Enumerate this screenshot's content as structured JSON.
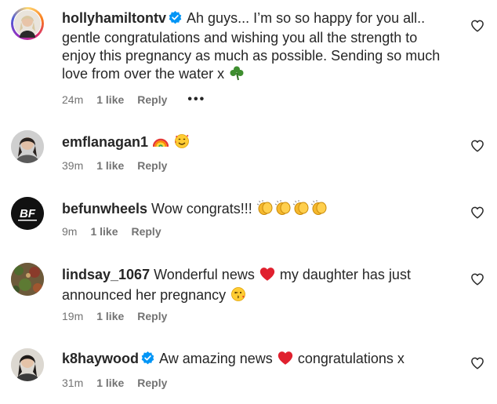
{
  "comments": [
    {
      "username": "hollyhamiltontv",
      "verified": true,
      "text_parts": [
        "Ah guys... I’m so so happy for you all.. gentle congratulations and wishing you all the strength to enjoy this pregnancy as much as possible. Sending so much love from over the water x "
      ],
      "emojis": [
        "shamrock"
      ],
      "time": "24m",
      "likes": "1 like",
      "reply": "Reply",
      "more": "•••"
    },
    {
      "username": "emflanagan1",
      "verified": false,
      "emojis": [
        "rainbow",
        "smiling-face-with-hearts"
      ],
      "time": "39m",
      "likes": "1 like",
      "reply": "Reply"
    },
    {
      "username": "befunwheels",
      "verified": false,
      "text": "Wow congrats!!!",
      "emojis": [
        "clapping-hands",
        "clapping-hands",
        "clapping-hands",
        "clapping-hands"
      ],
      "avatar_text": "BF",
      "time": "9m",
      "likes": "1 like",
      "reply": "Reply"
    },
    {
      "username": "lindsay_1067",
      "verified": false,
      "text_a": "Wonderful news",
      "text_b": "my daughter has just announced her pregnancy",
      "emojis": [
        "red-heart",
        "face-blowing-kiss"
      ],
      "time": "19m",
      "likes": "1 like",
      "reply": "Reply"
    },
    {
      "username": "k8haywood",
      "verified": true,
      "text_a": "Aw amazing news",
      "text_b": "congratulations x",
      "emojis": [
        "red-heart"
      ],
      "time": "31m",
      "likes": "1 like",
      "reply": "Reply"
    }
  ],
  "icons": {
    "verified_color": "#0095f6",
    "heart_outline": "heart-outline-icon"
  }
}
